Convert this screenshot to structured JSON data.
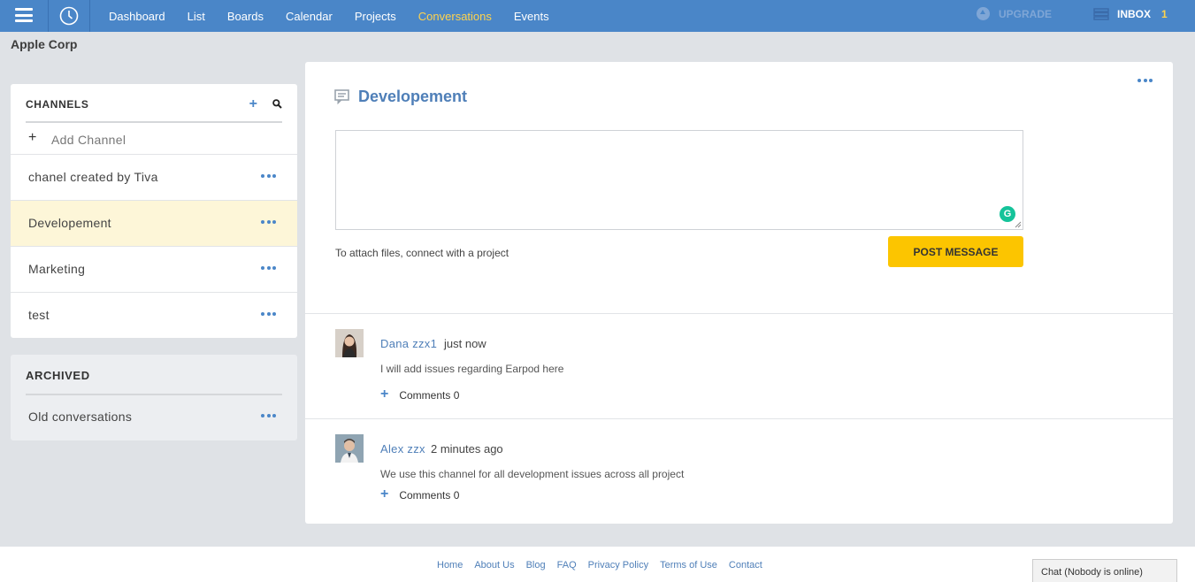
{
  "nav": {
    "items": [
      {
        "label": "Dashboard"
      },
      {
        "label": "List"
      },
      {
        "label": "Boards"
      },
      {
        "label": "Calendar"
      },
      {
        "label": "Projects"
      },
      {
        "label": "Conversations",
        "active": true
      },
      {
        "label": "Events"
      }
    ],
    "upgrade_label": "UPGRADE",
    "inbox_label": "INBOX",
    "inbox_count": "1"
  },
  "company_name": "Apple Corp",
  "channels": {
    "title": "CHANNELS",
    "add_label": "Add Channel",
    "items": [
      {
        "name": "chanel created by Tiva"
      },
      {
        "name": "Developement",
        "selected": true
      },
      {
        "name": "Marketing"
      },
      {
        "name": "test"
      }
    ]
  },
  "archived": {
    "title": "ARCHIVED",
    "items": [
      {
        "name": "Old conversations"
      }
    ]
  },
  "conversation": {
    "title": "Developement",
    "editor_value": "",
    "attach_note": "To attach files, connect with a project",
    "post_label": "POST MESSAGE",
    "messages": [
      {
        "author": "Dana zzx1",
        "time": "just now",
        "body": "I will add issues regarding Earpod here",
        "comments_label": "Comments 0"
      },
      {
        "author": "Alex zzx",
        "time": "2 minutes ago",
        "body": "We use this channel for all development issues across all project",
        "comments_label": "Comments 0"
      }
    ]
  },
  "footer": {
    "links": [
      "Home",
      "About Us",
      "Blog",
      "FAQ",
      "Privacy Policy",
      "Terms of Use",
      "Contact"
    ],
    "chat_label": "Chat (Nobody is online)"
  },
  "colors": {
    "topbar": "#4a86c8",
    "accent_yellow": "#fcc500",
    "active_nav": "#ffd34d",
    "selected_row": "#fdf6d8",
    "link_blue": "#4f7fb8"
  }
}
